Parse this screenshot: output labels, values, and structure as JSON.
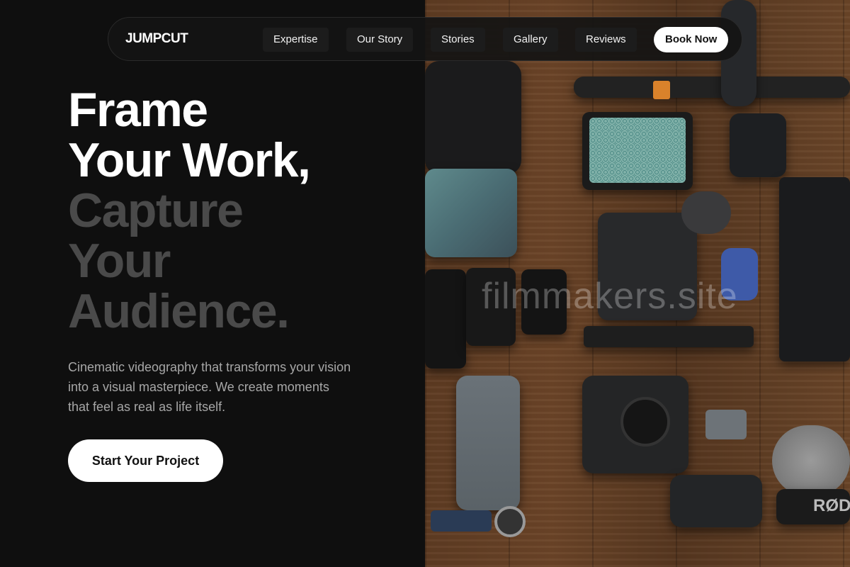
{
  "nav": {
    "logo": "JUMPCUT",
    "items": [
      {
        "label": "Expertise"
      },
      {
        "label": "Our Story"
      },
      {
        "label": "Stories"
      },
      {
        "label": "Gallery"
      },
      {
        "label": "Reviews"
      }
    ],
    "book_label": "Book Now"
  },
  "hero": {
    "line1": "Frame",
    "line2": "Your Work,",
    "line3": "Capture",
    "line4": "Your",
    "line5": "Audience.",
    "description": "Cinematic videography that transforms your vision into a visual masterpiece. We create moments that feel as real as life itself.",
    "cta_label": "Start Your Project"
  },
  "image": {
    "watermark": "filmmakers.site",
    "brand_text": "RØD"
  },
  "colors": {
    "background": "#0f0f0f",
    "headline_primary": "#ffffff",
    "headline_muted": "#4a4a4a",
    "body_text": "#a7a7a7",
    "button_bg": "#ffffff"
  }
}
